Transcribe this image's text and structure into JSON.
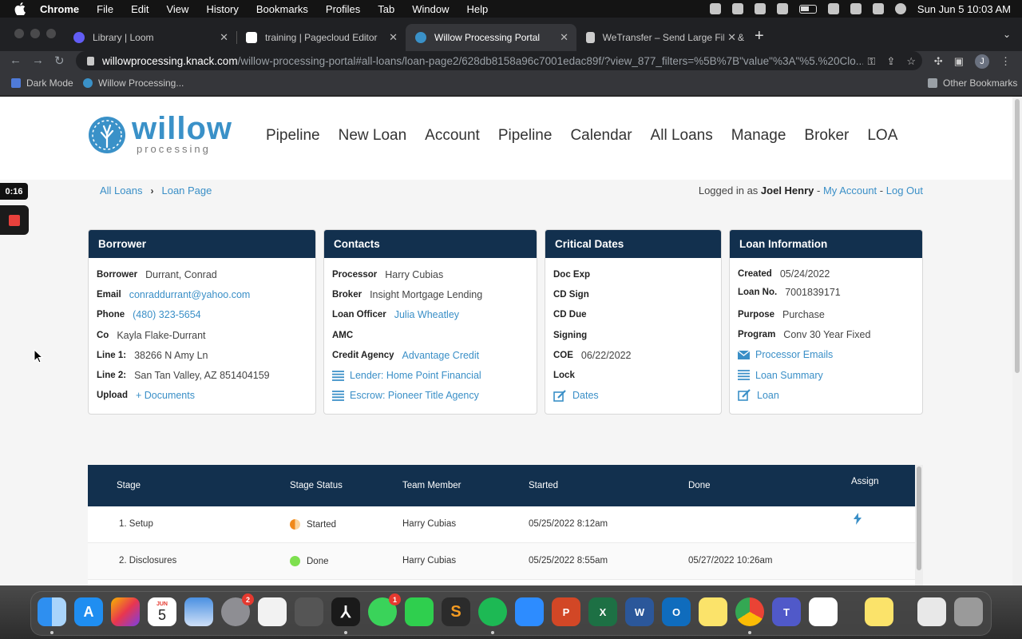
{
  "menubar": {
    "app": "Chrome",
    "items": [
      "File",
      "Edit",
      "View",
      "History",
      "Bookmarks",
      "Profiles",
      "Tab",
      "Window",
      "Help"
    ],
    "clock": "Sun Jun 5  10:03 AM"
  },
  "tabs": [
    {
      "title": "Library | Loom",
      "color": "#625df5"
    },
    {
      "title": "training | Pagecloud Editor",
      "color": "#ffffff"
    },
    {
      "title": "Willow Processing Portal",
      "color": "#3a91c8"
    },
    {
      "title": "WeTransfer – Send Large Files &",
      "color": "#cccccc"
    }
  ],
  "address": {
    "host": "willowprocessing.knack.com",
    "path": "/willow-processing-portal#all-loans/loan-page2/628db8158a96c7001edac89f/?view_877_filters=%5B%7B\"value\"%3A\"%5.%20Clo..."
  },
  "bookmarks": {
    "items": [
      "Dark Mode",
      "Willow Processing..."
    ],
    "other": "Other Bookmarks"
  },
  "profile_initial": "J",
  "site": {
    "logo_main": "willow",
    "logo_sub": "processing",
    "nav": [
      "Pipeline",
      "New Loan",
      "Account",
      "Pipeline",
      "Calendar",
      "All Loans",
      "Manage",
      "Broker",
      "LOA"
    ]
  },
  "breadcrumb": [
    "All Loans",
    "Loan Page"
  ],
  "session": {
    "prefix": "Logged in as",
    "user": "Joel Henry",
    "my_account": "My Account",
    "logout": "Log Out"
  },
  "borrower": {
    "title": "Borrower",
    "rows": [
      {
        "label": "Borrower",
        "value": "Durrant, Conrad"
      },
      {
        "label": "Email",
        "value": "conraddurrant@yahoo.com"
      },
      {
        "label": "Phone",
        "value": "(480) 323-5654"
      },
      {
        "label": "Co",
        "value": "Kayla Flake-Durrant"
      },
      {
        "label": "Line 1:",
        "value": "38266 N Amy Ln"
      },
      {
        "label": "Line 2:",
        "value": "San Tan Valley, AZ 851404159"
      },
      {
        "label": "Upload",
        "value": "+ Documents"
      }
    ]
  },
  "contacts": {
    "title": "Contacts",
    "rows": [
      {
        "label": "Processor",
        "value": "Harry Cubias"
      },
      {
        "label": "Broker",
        "value": "Insight Mortgage Lending"
      },
      {
        "label": "Loan Officer",
        "value": "Julia Wheatley"
      },
      {
        "label": "AMC",
        "value": ""
      },
      {
        "label": "Credit Agency",
        "value": "Advantage Credit"
      }
    ],
    "links": [
      "Lender: Home Point Financial",
      "Escrow: Pioneer Title Agency"
    ]
  },
  "critical_dates": {
    "title": "Critical Dates",
    "rows": [
      {
        "label": "Doc Exp",
        "value": ""
      },
      {
        "label": "CD Sign",
        "value": ""
      },
      {
        "label": "CD Due",
        "value": ""
      },
      {
        "label": "Signing",
        "value": ""
      },
      {
        "label": "COE",
        "value": "06/22/2022"
      },
      {
        "label": "Lock",
        "value": ""
      }
    ],
    "link": "Dates"
  },
  "loan_info": {
    "title": "Loan Information",
    "rows": [
      {
        "label": "Created",
        "value": "05/24/2022"
      },
      {
        "label": "Loan No.",
        "value": "7001839171"
      },
      {
        "label": "Purpose",
        "value": "Purchase"
      },
      {
        "label": "Program",
        "value": "Conv 30 Year Fixed"
      }
    ],
    "links": [
      "Processor Emails",
      "Loan Summary",
      "Loan"
    ]
  },
  "stages": {
    "columns": [
      "Stage",
      "Stage Status",
      "Team Member",
      "Started",
      "Done",
      "Assign"
    ],
    "rows": [
      {
        "stage": "1. Setup",
        "status": "Started",
        "status_color": "#f0891a",
        "member": "Harry Cubias",
        "started": "05/25/2022 8:12am",
        "done": ""
      },
      {
        "stage": "2. Disclosures",
        "status": "Done",
        "status_color": "#7ee04f",
        "member": "Harry Cubias",
        "started": "05/25/2022 8:55am",
        "done": "05/27/2022 10:26am"
      }
    ]
  },
  "loom": {
    "timer": "0:16"
  },
  "dock_badges": {
    "system_prefs": "2",
    "messages": "1",
    "calendar_day": "5",
    "calendar_month": "JUN"
  }
}
